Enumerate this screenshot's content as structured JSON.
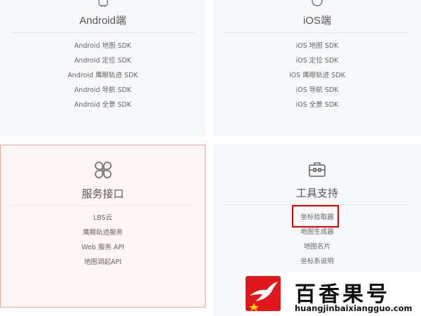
{
  "cards": {
    "android": {
      "title": "Android端",
      "links": [
        "Android 地图 SDK",
        "Android 定位 SDK",
        "Android 鹰眼轨迹 SDK",
        "Android 导航 SDK",
        "Android 全景 SDK"
      ]
    },
    "ios": {
      "title": "iOS端",
      "links": [
        "iOS 地图 SDK",
        "iOS 定位 SDK",
        "iOS 鹰眼轨迹 SDK",
        "iOS 导航 SDK",
        "iOS 全景 SDK"
      ]
    },
    "service": {
      "title": "服务接口",
      "icon": "clover-grid-icon",
      "links": [
        "LBS云",
        "鹰眼轨迹服务",
        "Web 服务 API",
        "地图调起API"
      ]
    },
    "tools": {
      "title": "工具支持",
      "icon": "toolbox-icon",
      "links": [
        "坐标拾取器",
        "地图生成器",
        "地图名片",
        "坐标系说明"
      ]
    }
  },
  "watermark": {
    "name": "百香果号",
    "url": "huangjinbaixiangguo.com",
    "logo": "swallow-logo-icon"
  },
  "colors": {
    "highlight": "#e00000",
    "selected_border": "#f0a78f",
    "logo_bg": "#e0181b"
  }
}
